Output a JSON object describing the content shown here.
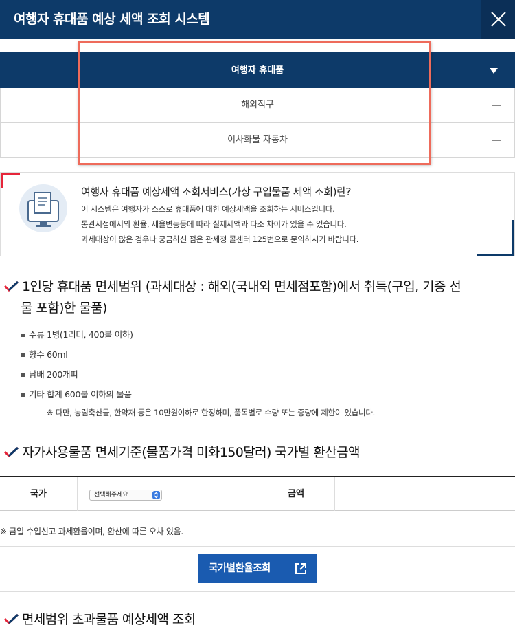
{
  "header": {
    "title": "여행자 휴대품 예상 세액 조회 시스템",
    "close_icon": "close-icon"
  },
  "menu": {
    "items": [
      {
        "label": "여행자 휴대품"
      },
      {
        "label": "해외직구"
      },
      {
        "label": "이사화물 자동차"
      }
    ]
  },
  "info": {
    "title": "여행자 휴대품 예상세액 조회서비스(가상 구입물품 세액 조회)란?",
    "lines": [
      "이 시스템은 여행자가 스스로 휴대품에 대한 예상세액을 조회하는 서비스입니다.",
      "통관시점에서의 환율, 세율변동등에 따라 실제세액과 다소 차이가 있을 수 있습니다.",
      "과세대상이 많은 경우나 궁금하신 점은 관세청 콜센터 125번으로 문의하시기 바랍니다."
    ]
  },
  "section1": {
    "title_line1": "1인당 휴대품 면세범위 (과세대상 : 해외(국내외 면세점포함)에서 취득(구입, 기증 선",
    "title_line2": "물 포함)한 물품)",
    "items": [
      "주류 1병(1리터, 400불 이하)",
      "향수 60ml",
      "담배 200개피",
      "기타 합계 600불 이하의 물품"
    ],
    "note": "※  다만, 농림축산물, 한약재 등은 10만원이하로 한정하며, 품목별로 수량 또는 중량에 제한이 있습니다."
  },
  "section2": {
    "title": "자가사용물품 면세기준(물품가격 미화150달러) 국가별 환산금액",
    "country_label": "국가",
    "select_value": "선택해주세요",
    "amount_label": "금액",
    "note": "※  금일 수입신고 과세환율이며, 환산에 따른 오차 있음.",
    "button_label": "국가별환율조회"
  },
  "section3": {
    "title": "면세범위 초과물품 예상세액 조회"
  },
  "colors": {
    "navy": "#0d3a69",
    "accent_red": "#e6253a",
    "button_blue": "#1a5bb0",
    "highlight": "#ee6b5b"
  }
}
